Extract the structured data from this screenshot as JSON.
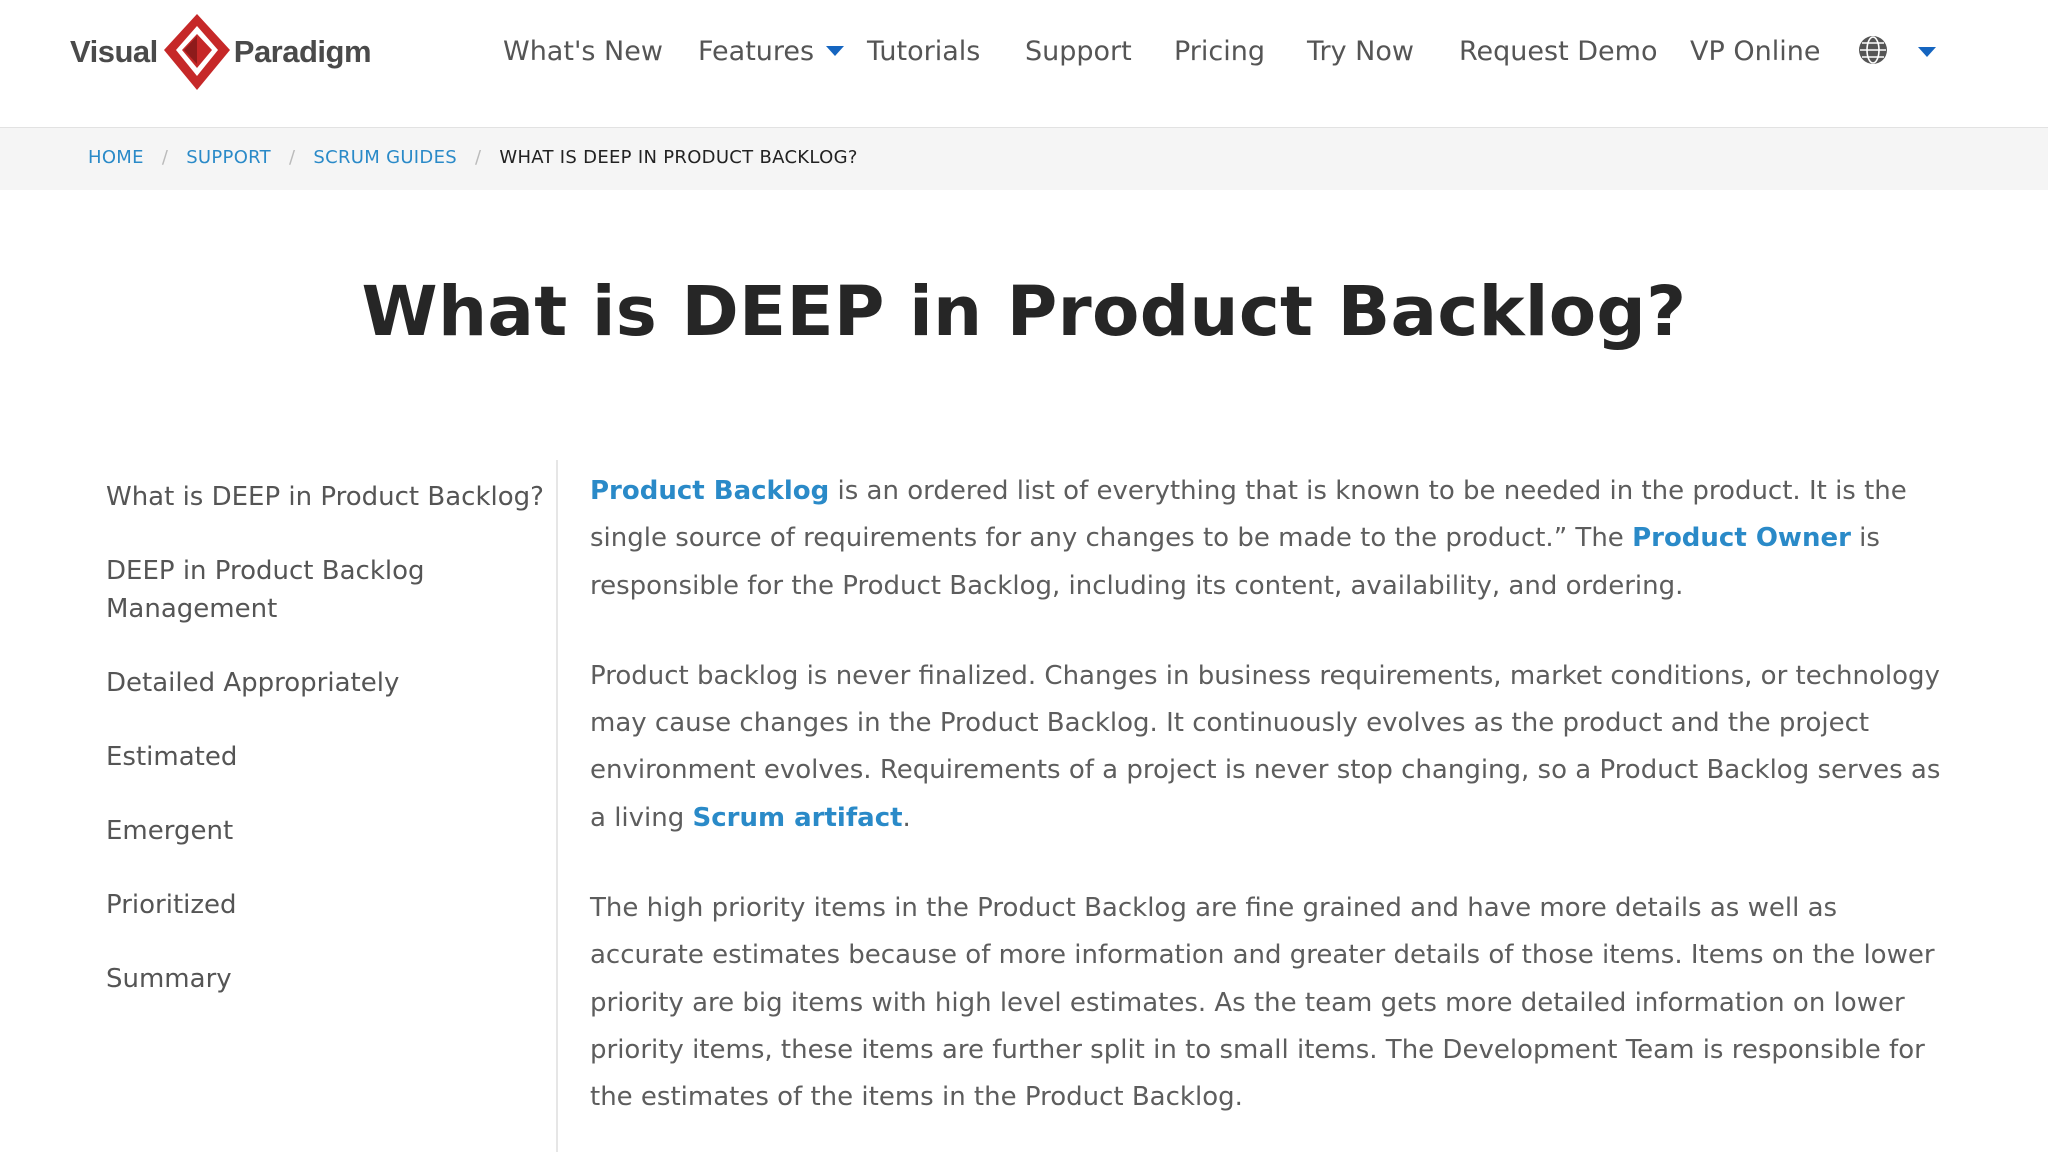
{
  "header": {
    "logo": {
      "left": "Visual",
      "right": "Paradigm"
    },
    "nav": [
      {
        "label": "What's New"
      },
      {
        "label": "Features",
        "has_dropdown": true
      },
      {
        "label": "Tutorials"
      },
      {
        "label": "Support"
      },
      {
        "label": "Pricing"
      },
      {
        "label": "Try Now"
      },
      {
        "label": "Request Demo"
      },
      {
        "label": "VP Online"
      }
    ],
    "language_icon": "globe-icon"
  },
  "breadcrumb": {
    "items": [
      "HOME",
      "SUPPORT",
      "SCRUM GUIDES"
    ],
    "current": "WHAT IS DEEP IN PRODUCT BACKLOG?",
    "separator": "/"
  },
  "page_title": "What is DEEP in Product Backlog?",
  "toc": [
    "What is DEEP in Product Backlog?",
    "DEEP in Product Backlog Management",
    "Detailed Appropriately",
    "Estimated",
    "Emergent",
    "Prioritized",
    "Summary"
  ],
  "content": {
    "p1": {
      "link1": "Product Backlog",
      "text1": " is an ordered list of everything that is known to be needed in the product. It is the single source of requirements for any changes to be made to the product.” The ",
      "link2": "Product Owner",
      "text2": " is responsible for the Product Backlog, including its content, availability, and ordering."
    },
    "p2": {
      "text1": "Product backlog is never finalized. Changes in business requirements, market conditions, or technology may cause changes in the Product Backlog. It continuously evolves as the product and the project environment evolves. Requirements of a project is never stop changing, so a Product Backlog serves as a living ",
      "link1": "Scrum artifact",
      "text2": "."
    },
    "p3": "The high priority items in the Product Backlog are fine grained and have more details as well as accurate estimates because of more information and greater details of those items. Items on the lower priority are big items with high level estimates. As the team gets more detailed information on lower priority items, these items are further split in to small items. The Development Team is responsible for the estimates of the items in the Product Backlog."
  },
  "colors": {
    "link": "#2a8ac8",
    "nav_caret": "#1565c0",
    "logo_red": "#c62828",
    "title": "#262626",
    "body_text": "#5d5d5d",
    "breadcrumb_bg": "#f5f5f5"
  }
}
